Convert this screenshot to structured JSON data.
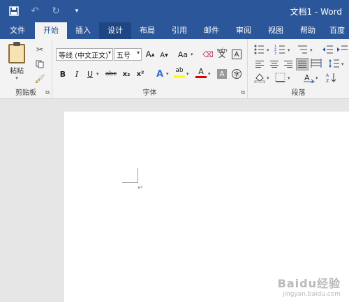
{
  "titlebar": {
    "title": "文档1 - Word",
    "icons": [
      "save-icon",
      "undo-icon",
      "redo-icon",
      "customize-qat-icon"
    ]
  },
  "tabs": [
    {
      "label": "文件"
    },
    {
      "label": "开始",
      "active": true
    },
    {
      "label": "插入"
    },
    {
      "label": "设计"
    },
    {
      "label": "布局"
    },
    {
      "label": "引用"
    },
    {
      "label": "邮件"
    },
    {
      "label": "审阅"
    },
    {
      "label": "视图"
    },
    {
      "label": "帮助"
    },
    {
      "label": "百度"
    }
  ],
  "clipboard": {
    "paste_label": "粘贴",
    "group_label": "剪贴板"
  },
  "font": {
    "font_name": "等线 (中文正文)",
    "font_size": "五号",
    "group_label": "字体",
    "wen_label": "文",
    "bold": "B",
    "italic": "I",
    "underline": "U",
    "strike": "abc",
    "subscript": "x₂",
    "superscript": "x²",
    "case": "Aa",
    "grow": "A",
    "shrink": "A",
    "effects": "A",
    "highlight": "ab",
    "color": "A",
    "shade": "A",
    "boxed": "A",
    "circled": "字",
    "pinyin_top": "wén",
    "pinyin_bottom": "文"
  },
  "paragraph": {
    "group_label": "段落"
  },
  "document": {
    "paragraph_mark": "↵"
  },
  "watermark": {
    "main": "Baidu经验",
    "sub": "jingyan.baidu.com"
  },
  "colors": {
    "brand": "#2b579a",
    "ribbon_bg": "#f3f3f3",
    "canvas_bg": "#e6e6e6",
    "highlight_yellow": "#ffff00",
    "font_red": "#e00000"
  }
}
